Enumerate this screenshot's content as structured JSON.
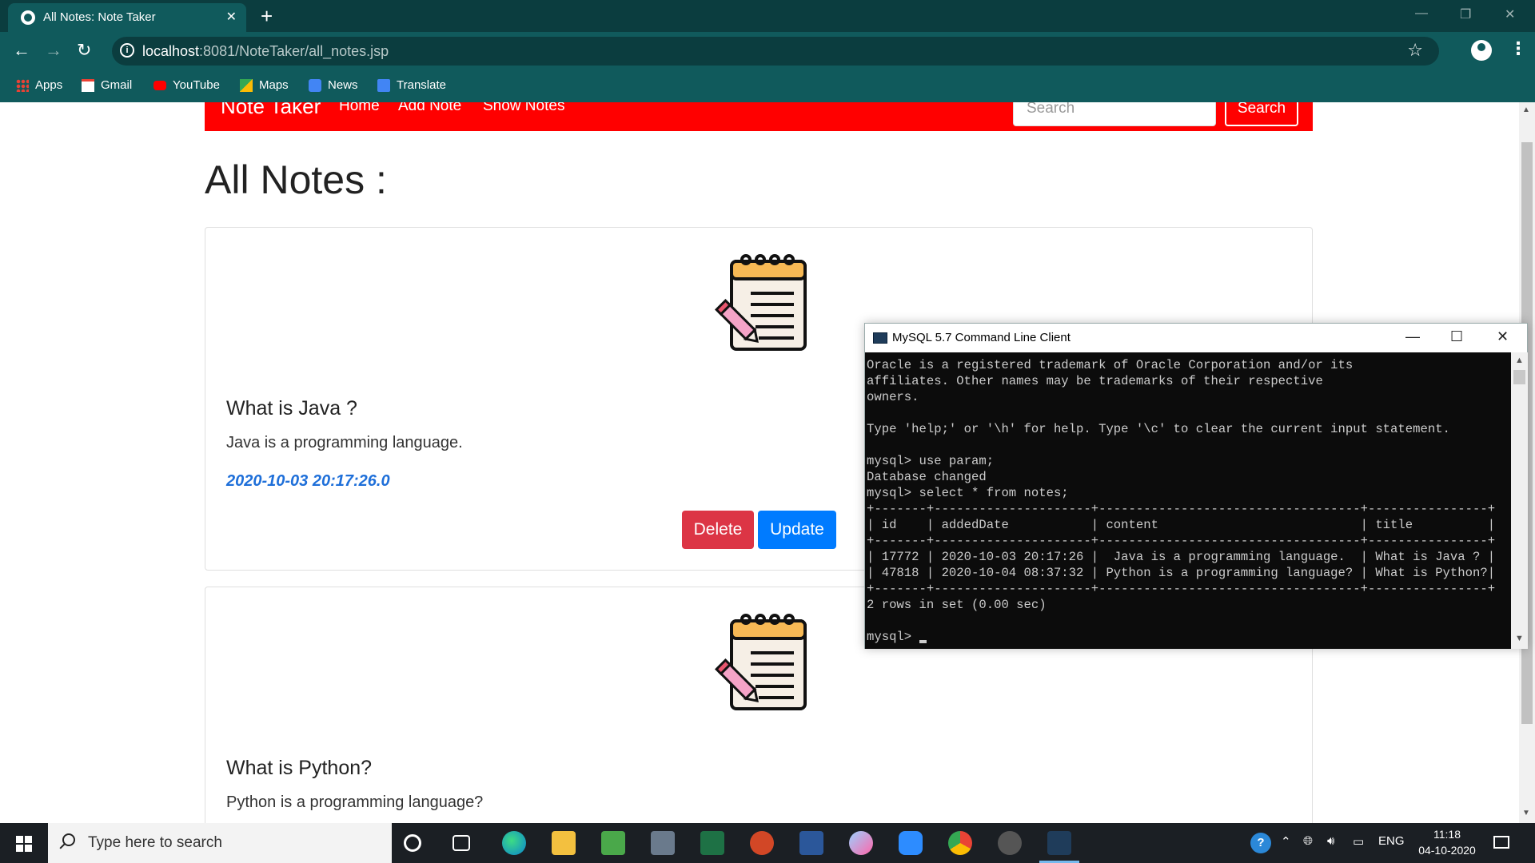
{
  "browser": {
    "tab_title": "All Notes: Note Taker",
    "url_host": "localhost",
    "url_rest": ":8081/NoteTaker/all_notes.jsp",
    "bookmarks": [
      "Apps",
      "Gmail",
      "YouTube",
      "Maps",
      "News",
      "Translate"
    ]
  },
  "navbar": {
    "brand": "Note Taker",
    "links": [
      "Home",
      "Add Note",
      "Show Notes"
    ],
    "search_placeholder": "Search",
    "search_button": "Search"
  },
  "page": {
    "heading": "All Notes :"
  },
  "notes": [
    {
      "title": "What is Java ?",
      "content": "Java is a programming language.",
      "date": "2020-10-03 20:17:26.0",
      "delete_label": "Delete",
      "update_label": "Update"
    },
    {
      "title": "What is Python?",
      "content": "Python is a programming language?"
    }
  ],
  "mysql_window": {
    "title": "MySQL 5.7 Command Line Client",
    "terminal_text": "Oracle is a registered trademark of Oracle Corporation and/or its\naffiliates. Other names may be trademarks of their respective\nowners.\n\nType 'help;' or '\\h' for help. Type '\\c' to clear the current input statement.\n\nmysql> use param;\nDatabase changed\nmysql> select * from notes;\n+-------+---------------------+-----------------------------------+----------------+\n| id    | addedDate           | content                           | title          |\n+-------+---------------------+-----------------------------------+----------------+\n| 17772 | 2020-10-03 20:17:26 |  Java is a programming language.  | What is Java ? |\n| 47818 | 2020-10-04 08:37:32 | Python is a programming language? | What is Python?|\n+-------+---------------------+-----------------------------------+----------------+\n2 rows in set (0.00 sec)\n\nmysql> "
  },
  "taskbar": {
    "search_placeholder": "Type here to search",
    "language": "ENG",
    "time": "11:18",
    "date": "04-10-2020"
  },
  "colors": {
    "navbar": "#ff0000",
    "delete": "#dc3545",
    "update": "#007bff",
    "date_text": "#1e6fd9"
  }
}
